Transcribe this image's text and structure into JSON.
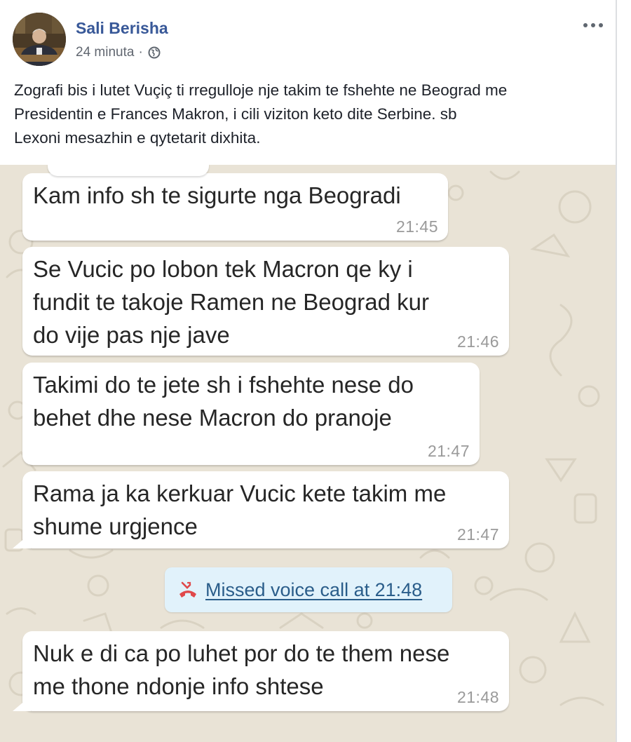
{
  "post": {
    "author": "Sali Berisha",
    "time": "24 minuta",
    "separator": "·",
    "text": "Zografi bis i lutet Vuçiç ti rregulloje nje takim te fshehte ne Beograd me\nPresidentin e Frances Makron, i cili viziton keto dite Serbine. sb\nLexoni mesazhin e qytetarit dixhita."
  },
  "chat": {
    "messages": [
      {
        "text": "Kam info sh te sigurte nga Beogradi",
        "time": "21:45"
      },
      {
        "text": "Se Vucic po lobon tek Macron qe ky i\nfundit te takoje Ramen ne  Beograd kur\ndo vije pas nje jave",
        "time": "21:46"
      },
      {
        "text": "Takimi do te jete sh i fshehte  nese do\nbehet dhe nese Macron do pranoje",
        "time": "21:47"
      },
      {
        "text": "Rama ja ka kerkuar Vucic kete takim me\nshume urgjence",
        "time": "21:47"
      },
      {
        "text": "Nuk e di ca po luhet por do te them nese\nme thone ndonje info shtese",
        "time": "21:48"
      }
    ],
    "missed_call": "Missed voice call at 21:48"
  },
  "icons": {
    "globe": "globe-icon",
    "more": "more-options-icon",
    "missed_call": "missed-call-icon"
  },
  "colors": {
    "author_link": "#385898",
    "chat_background": "#e9e3d6",
    "missed_call_bg": "#e1f2fb",
    "missed_call_text": "#2a5d8a",
    "missed_call_icon": "#e0484a"
  }
}
